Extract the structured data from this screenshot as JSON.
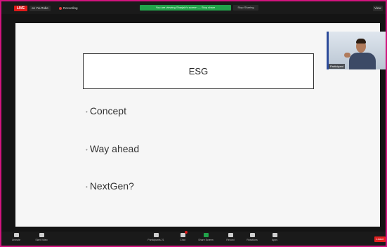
{
  "top_bar": {
    "live_label": "LIVE",
    "youtube_label": "on YouTube",
    "recording_label": "Recording",
    "sharing_banner": "You are viewing Sharjah's screen — Stop share",
    "stop_share_label": "Stop Sharing",
    "view_label": "View"
  },
  "slide": {
    "title": "ESG",
    "bullets": [
      "Concept",
      "Way ahead",
      "NextGen?"
    ]
  },
  "video_tile": {
    "name_label": "Participant"
  },
  "toolbar": {
    "unmute_label": "Unmute",
    "start_video_label": "Start Video",
    "participants_label": "Participants",
    "participants_count": "21",
    "chat_label": "Chat",
    "share_label": "Share Screen",
    "record_label": "Record",
    "reactions_label": "Reactions",
    "apps_label": "Apps",
    "leave_label": "Leave"
  },
  "colors": {
    "frame_border": "#d2147e",
    "live_red": "#e01a1a",
    "share_green": "#21a34a",
    "leave_red": "#e02020"
  }
}
